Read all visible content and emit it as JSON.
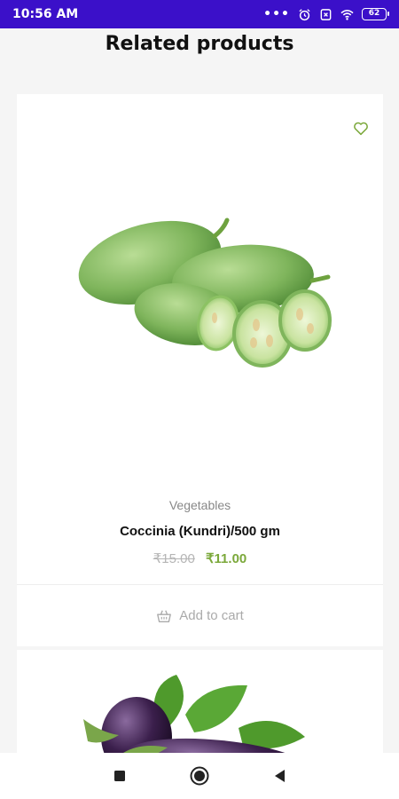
{
  "status_bar": {
    "time": "10:56 AM",
    "battery": "62",
    "icons": [
      "more-dots-icon",
      "alarm-icon",
      "sim-icon",
      "wifi-icon",
      "battery-icon"
    ]
  },
  "section": {
    "title": "Related products"
  },
  "products": [
    {
      "category": "Vegetables",
      "name": "Coccinia (Kundri)/500 gm",
      "old_price": "₹15.00",
      "price": "₹11.00",
      "add_to_cart": "Add to cart",
      "image": "coccinia-image",
      "wishlist_icon": "heart-icon"
    },
    {
      "image": "eggplant-image"
    }
  ],
  "nav_bar": {
    "icons": [
      "recents-icon",
      "home-icon",
      "back-icon"
    ]
  },
  "colors": {
    "status_bar": "#3b10c9",
    "accent_green": "#7ba83a",
    "old_price": "#b5b5b5",
    "category_text": "#888888"
  }
}
